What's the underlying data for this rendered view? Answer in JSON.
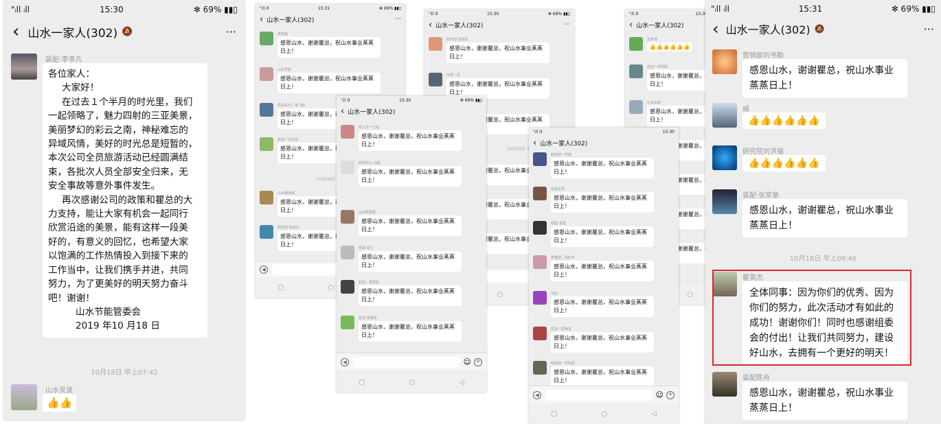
{
  "s1": {
    "sig": "\"ᵢll ᵢll",
    "time": "15:30",
    "battery": "✻ 69% ▮▮▯",
    "title": "山水一家人(302)",
    "back": "‹",
    "more": "···",
    "m1": {
      "name": "装配-李孝凡",
      "lines": [
        "各位家人：",
        "大家好！",
        "在过去１个半月的时光里，我们",
        "一起领略了，魅力四射的三亚美景，",
        "美丽梦幻的彩云之南，神秘难忘的",
        "异域风情，美好的时光总是短暂的，",
        "本次公司全员旅游活动已经圆满结",
        "束，各批次人员全部安全归来，无",
        "安全事故等意外事件发生。",
        "再次感谢公司的政策和瞿总的大",
        "力支持，能让大家有机会一起同行",
        "欣赏沿途的美景，能有这样一段美",
        "好的，有意义的回忆，也希望大家",
        "以饱满的工作热情投入到接下来的",
        "工作当中，让我们携手并进，共同",
        "努力，为了更美好的明天努力奋斗",
        "吧！谢谢！",
        "山水节能管委会",
        "2019 年10 月18 日"
      ]
    },
    "ts": "10月18日 早上07:42",
    "m2": {
      "name": "山水吴波",
      "text": "👍👍"
    }
  },
  "p2": {
    "sig": "\"ᵢll ᵢll",
    "time": "15:31",
    "battery": "✻ 69% ▮▮▯",
    "title": "山水一家人(302)",
    "back": "‹",
    "more": "···",
    "names": [
      "奥燕娟",
      "山水罗夏",
      "机加车间—李飞跃",
      "机加一张志强",
      "山水精准度",
      "研究院-李成元"
    ],
    "text": "感恩山水，谢谢瞿总，祝山水事业蒸蒸日上！",
    "ts": "10月18日 早上"
  },
  "p3": {
    "sig": "\"ᵢll ᵢll",
    "time": "15:30",
    "battery": "✻ 69% ▮▮▯",
    "title": "山水一家人(302)",
    "back": "‹",
    "names": [
      "家工办一王雨",
      "新技中心·冯斌",
      "山水质量部",
      "营销·周力",
      "机加、曹新民",
      "生安·周路强"
    ],
    "text": "感恩山水，谢谢瞿总，祝山水事业蒸蒸日上！",
    "ts": "10月18日 早上08"
  },
  "p4": {
    "sig": "\"ᵢll ᵢll",
    "time": "15:30",
    "battery": "✻ 69% ▮▮▯",
    "title": "山水一家人(302)",
    "back": "‹",
    "more": "···",
    "names": [
      "财务部·廖成武",
      "市场一毛",
      "山水周利",
      "计划部一王德平",
      "计划部—周建波",
      "计划·曹帆"
    ],
    "text": "感恩山水，谢谢瞿总，祝山水事业蒸蒸日上！",
    "ts": "10月18日 早上08:06"
  },
  "p5": {
    "sig": "\"ᵢll ᵢll",
    "time": "15:30",
    "title": "山水一家人(302)",
    "back": "‹",
    "names": [
      "制造部一李栋",
      "机加王凯",
      "研配-李超",
      "质量部，周彩平",
      "品质部",
      "马远",
      "机加—唐海龙",
      "制造部一邓科辉"
    ],
    "text": "感恩山水，谢谢瞿总，祝山水事业蒸蒸日上！"
  },
  "p6": {
    "sig": "\"ᵢll ᵢll",
    "time": "15:30",
    "title": "山水一家人(302)",
    "back": "‹",
    "names": [
      "彭英涛",
      "机加一李明珠",
      "山水采波",
      "机加张宏",
      "装配车间-谢宏亮",
      "制造部、夏秋林",
      "机加装配一童军"
    ],
    "text": "感恩山水，谢谢瞿总，祝山水事业蒸蒸日上！",
    "thumbs": "👍👍👍👍👍👍"
  },
  "p7": {
    "sig": "\"ᵢll ᵢll",
    "time": "15:31",
    "battery": "✻ 69% ▮▮▯",
    "title": "山水一家人(302)",
    "back": "‹",
    "more": "···",
    "m1": {
      "name": "营销部刘书勤",
      "text": "感恩山水，谢谢瞿总，祝山水事业蒸蒸日上！"
    },
    "m2": {
      "name": "威",
      "text": "👍👍👍👍👍👍"
    },
    "m3": {
      "name": "研究院刘洪福",
      "text": "👍👍👍👍👍👍"
    },
    "m4": {
      "name": "装配·张家豪",
      "text": "感恩山水，谢谢瞿总，祝山水事业蒸蒸日上！"
    },
    "ts": "10月18日 早上08:46",
    "m5": {
      "name": "瞿英杰",
      "text": "全体同事：因为你们的优秀、因为你们的努力，此次活动才有如此的成功！谢谢你们！同时也感谢组委会的付出！让我们共同努力，建设好山水，去拥有一个更好的明天！"
    },
    "m6": {
      "name": "装配陈舟",
      "text": "感恩山水，谢谢瞿总，祝山水事业蒸蒸日上！"
    }
  },
  "colors": {
    "highlight": "#d9272d",
    "bg": "#ededed"
  }
}
